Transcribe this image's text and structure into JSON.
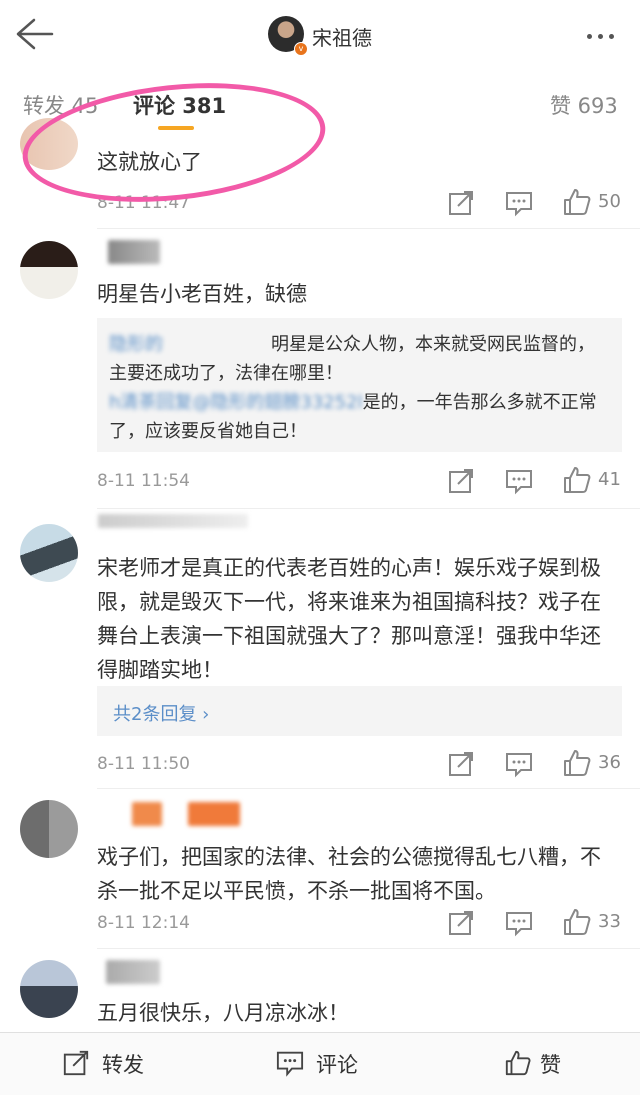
{
  "header": {
    "title": "宋祖德",
    "verified_badge": "v"
  },
  "tabs": [
    {
      "label": "转发 45"
    },
    {
      "label": "评论 381"
    },
    {
      "label": "赞 693"
    }
  ],
  "comments": [
    {
      "text": "这就放心了",
      "time": "8-11 11:47",
      "likes": "50"
    },
    {
      "text": "明星告小老百姓，缺德",
      "time": "8-11 11:54",
      "likes": "41",
      "replies": [
        {
          "author": "隐形的",
          "text": "明星是公众人物，本来就受网民监督的，主要还成功了，法律在哪里！"
        },
        {
          "author": "h清茶回复@隐形的翅膀33252l",
          "text": "是的，一年告那么多就不正常了，应该要反省她自己！"
        }
      ]
    },
    {
      "text": "宋老师才是真正的代表老百姓的心声！娱乐戏子娱到极限，就是毁灭下一代，将来谁来为祖国搞科技？戏子在舞台上表演一下祖国就强大了？那叫意淫！强我中华还得脚踏实地！",
      "time": "8-11 11:50",
      "likes": "36",
      "reply_link": "共2条回复 ›"
    },
    {
      "text": "戏子们，把国家的法律、社会的公德搅得乱七八糟，不杀一批不足以平民愤，不杀一批国将不国。",
      "time": "8-11 12:14",
      "likes": "33"
    },
    {
      "text": "五月很快乐，八月凉冰冰！"
    }
  ],
  "bottom_bar": {
    "repost": "转发",
    "comment": "评论",
    "like": "赞"
  },
  "colors": {
    "accent": "#f6a623",
    "link": "#5b8ec8",
    "annotation": "#f25aa8"
  }
}
